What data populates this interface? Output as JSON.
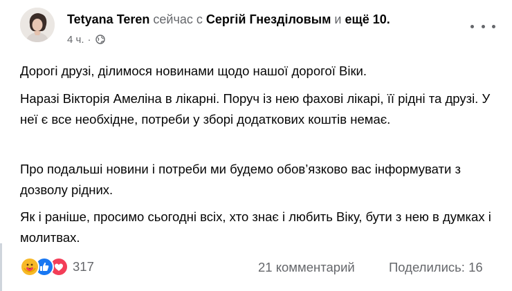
{
  "post": {
    "author": "Tetyana Teren",
    "with_prefix": "сейчас с",
    "with_name": "Сергій Гнезділовым",
    "with_and": "и",
    "with_others": "ещё 10.",
    "time": "4 ч.",
    "dot": "·",
    "privacy_icon": "globe-icon",
    "paragraphs": [
      "Дорогі друзі, ділимося новинами щодо нашої дорогої Віки.",
      "Наразі Вікторія Амеліна в лікарні. Поруч із нею фахові лікарі, її рідні та друзі. У неї є все необхідне, потреби у зборі додаткових коштів немає.",
      "Про подальші новини і потреби ми будемо обов’язково вас інформувати з дозволу рідних.",
      "Як і раніше, просимо сьогодні всіх, хто знає і любить Віку, бути з нею в думках і молитвах."
    ]
  },
  "footer": {
    "reaction_icons": [
      "care-icon",
      "like-icon",
      "love-icon"
    ],
    "reaction_count": "317",
    "comments": "21 комментарий",
    "shares": "Поделились: 16"
  },
  "colors": {
    "muted": "#65676b",
    "like": "#1877f2",
    "love": "#f33e58",
    "care": "#f7b928"
  }
}
